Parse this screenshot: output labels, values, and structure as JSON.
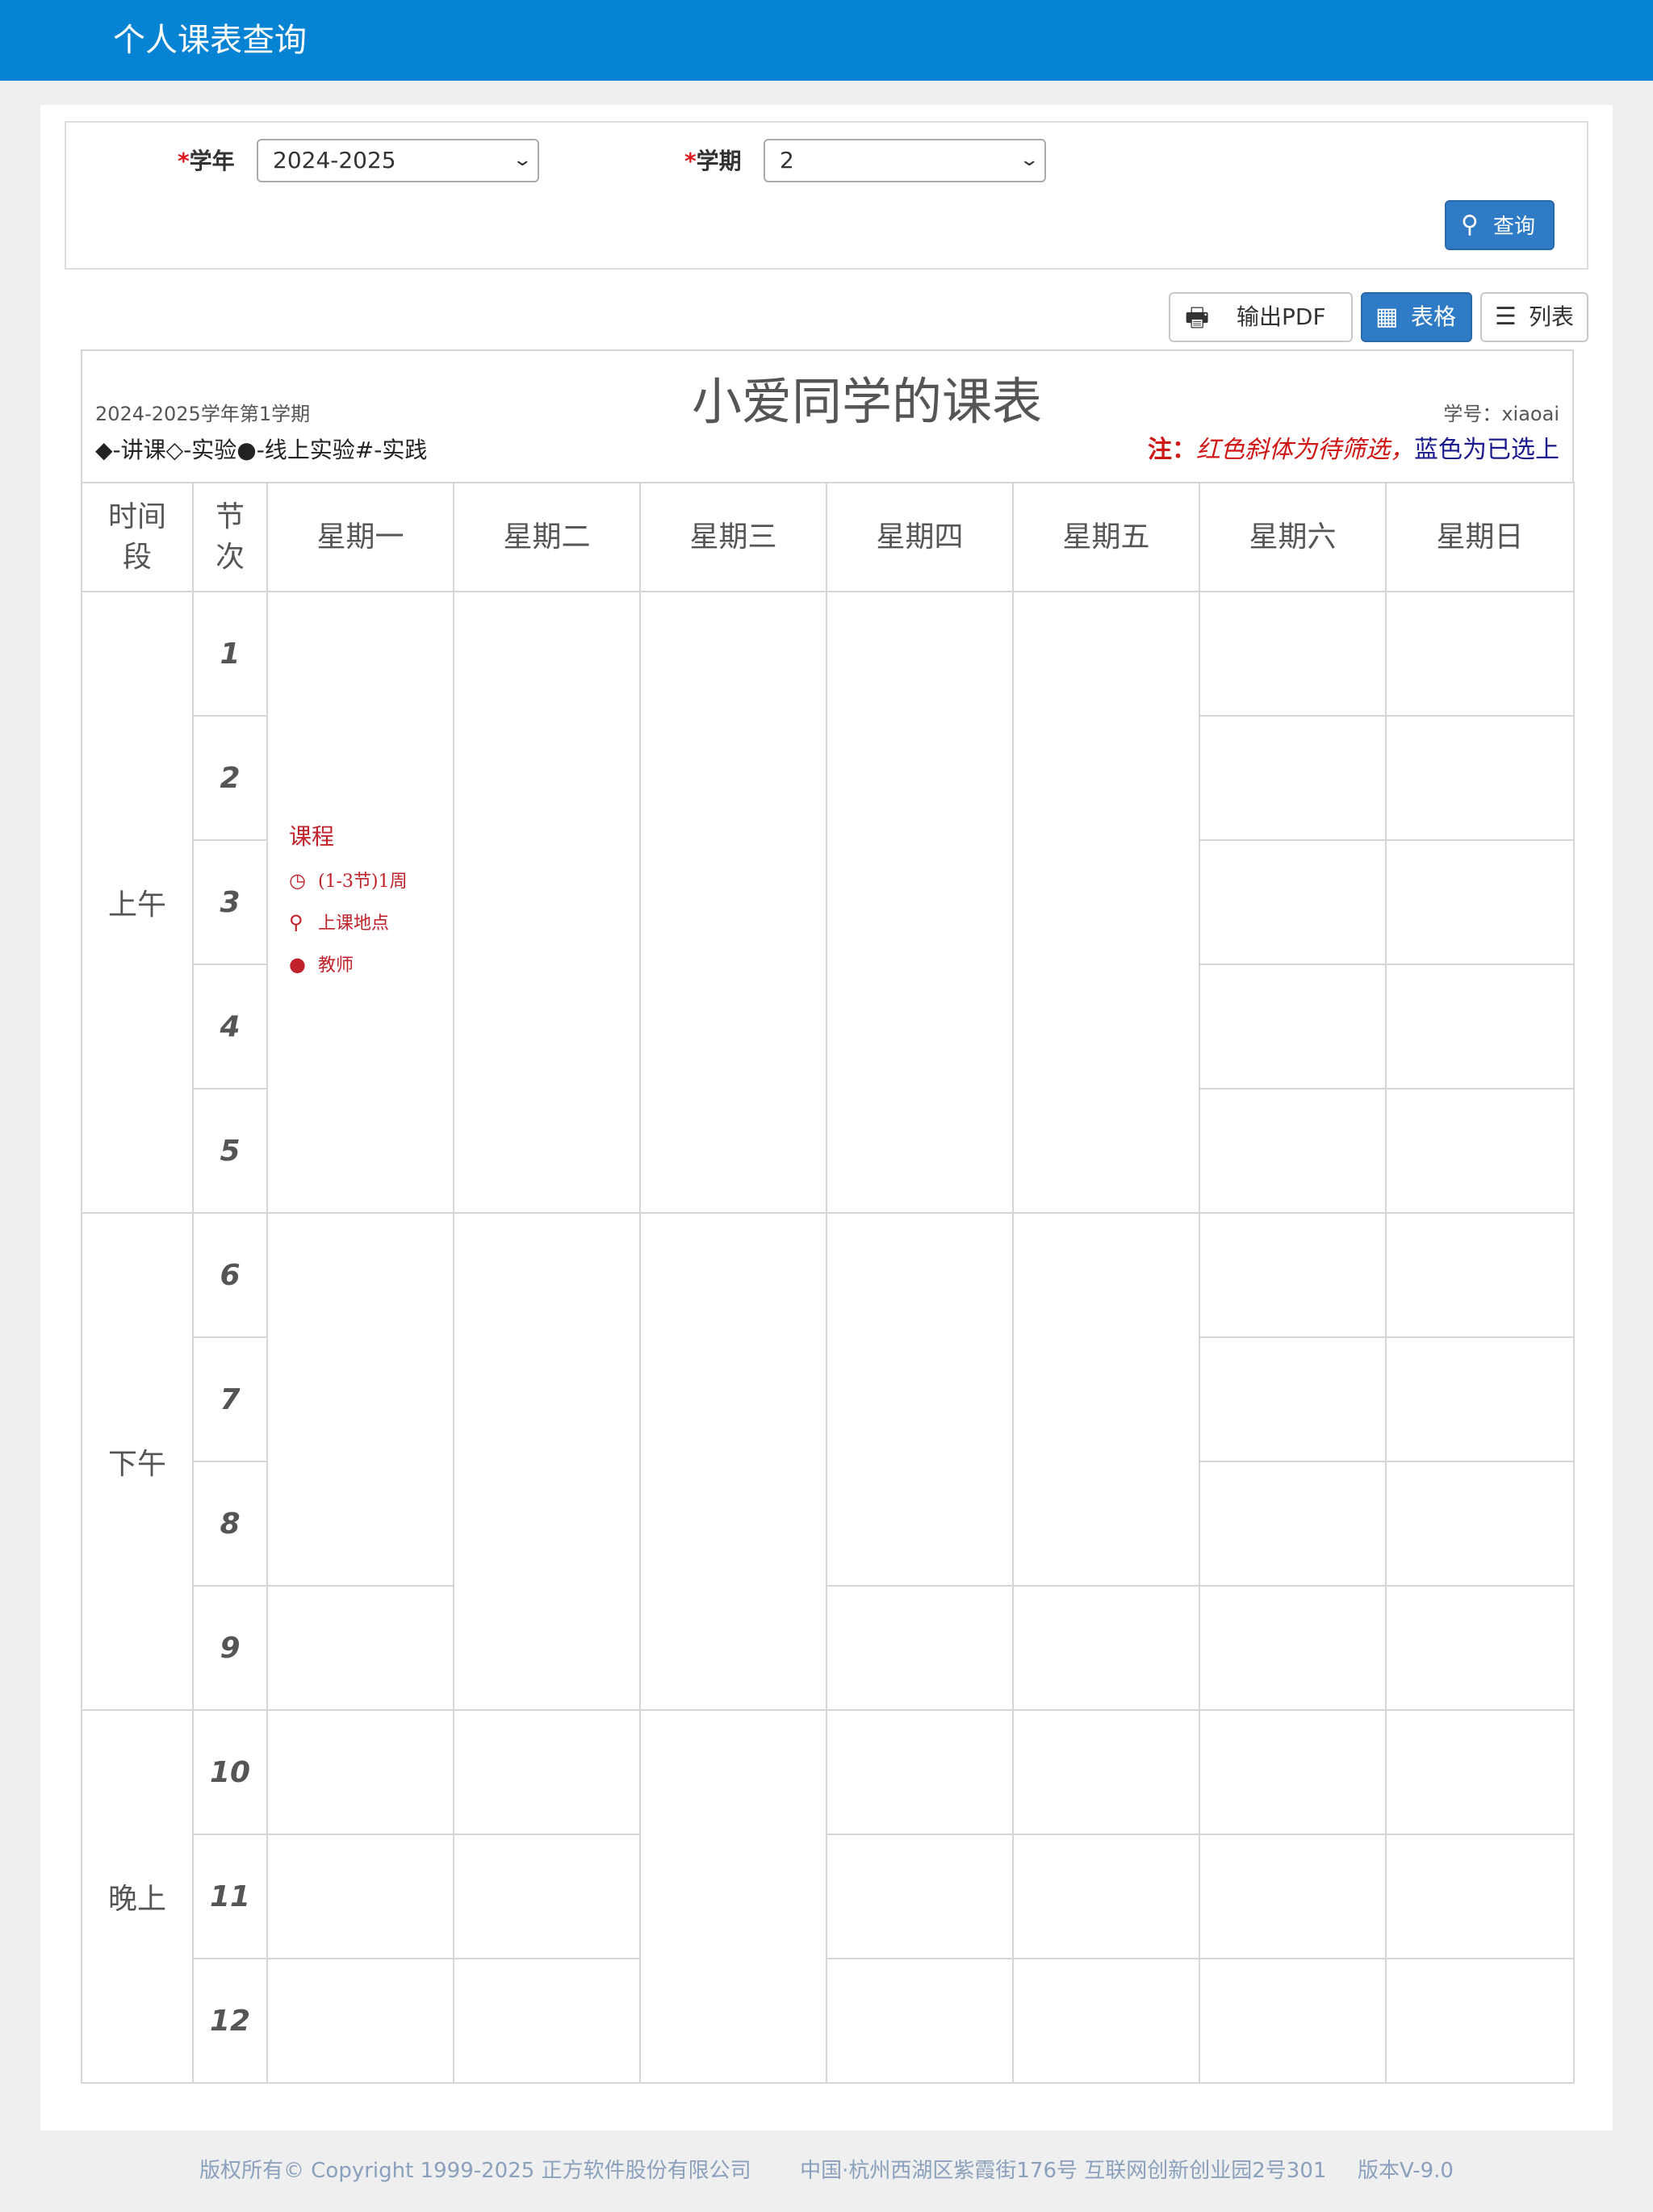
{
  "header": {
    "title": "个人课表查询"
  },
  "filter": {
    "year_required": "*",
    "year_label": "学年",
    "year_value": "2024-2025",
    "term_required": "*",
    "term_label": "学期",
    "term_value": "2",
    "query_icon": "search-icon",
    "query_label": "查询"
  },
  "view": {
    "pdf_icon": "printer-icon",
    "pdf_label": "输出PDF",
    "grid_icon": "grid-icon",
    "grid_label": "表格",
    "list_icon": "list-icon",
    "list_label": "列表",
    "active": "表格"
  },
  "timetable": {
    "term_text": "2024-2025学年第1学期",
    "legend": "◆-讲课◇-实验●-线上实验#-实践",
    "title": "小爱同学的课表",
    "student_id": "学号：xiaoai",
    "note_prefix": "注：",
    "note_red": "红色斜体为待筛选",
    "note_sep": "，",
    "note_blue": "蓝色为已选上",
    "colors": {
      "pending": "#c0212a",
      "selected": "#1a1a8c"
    },
    "headers": {
      "period": "时间段",
      "slot": "节次"
    },
    "days": [
      "星期一",
      "星期二",
      "星期三",
      "星期四",
      "星期五",
      "星期六",
      "星期日"
    ],
    "periods": [
      "上午",
      "下午",
      "晚上"
    ],
    "slots": [
      "1",
      "2",
      "3",
      "4",
      "5",
      "6",
      "7",
      "8",
      "9",
      "10",
      "11",
      "12"
    ],
    "course": {
      "name": "课程",
      "time": "(1-3节)1周",
      "location": "上课地点",
      "teacher": "教师",
      "time_icon": "clock-icon",
      "location_icon": "map-pin-icon",
      "teacher_icon": "person-icon"
    }
  },
  "footer": {
    "copyright": "版权所有© Copyright 1999-2025 正方软件股份有限公司",
    "address": "中国·杭州西湖区紫霞街176号 互联网创新创业园2号301",
    "version": "版本V-9.0"
  }
}
